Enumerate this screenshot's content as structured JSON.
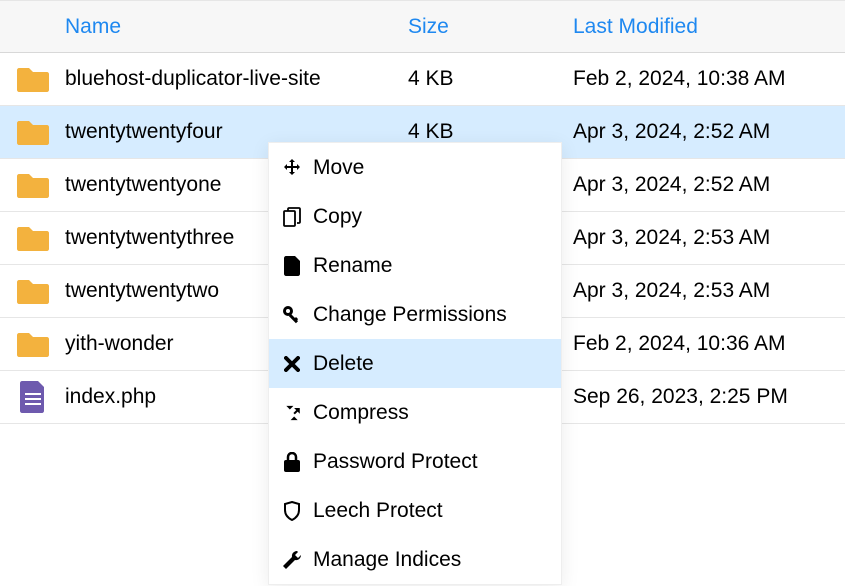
{
  "columns": {
    "name": "Name",
    "size": "Size",
    "modified": "Last Modified"
  },
  "rows": [
    {
      "name": "bluehost-duplicator-live-site",
      "size": "4 KB",
      "modified": "Feb 2, 2024, 10:38 AM",
      "type": "folder"
    },
    {
      "name": "twentytwentyfour",
      "size": "4 KB",
      "modified": "Apr 3, 2024, 2:52 AM",
      "type": "folder"
    },
    {
      "name": "twentytwentyone",
      "size": "",
      "modified": "Apr 3, 2024, 2:52 AM",
      "type": "folder"
    },
    {
      "name": "twentytwentythree",
      "size": "",
      "modified": "Apr 3, 2024, 2:53 AM",
      "type": "folder"
    },
    {
      "name": "twentytwentytwo",
      "size": "",
      "modified": "Apr 3, 2024, 2:53 AM",
      "type": "folder"
    },
    {
      "name": "yith-wonder",
      "size": "",
      "modified": "Feb 2, 2024, 10:36 AM",
      "type": "folder"
    },
    {
      "name": "index.php",
      "size": "",
      "modified": "Sep 26, 2023, 2:25 PM",
      "type": "file"
    }
  ],
  "context_menu": {
    "move": "Move",
    "copy": "Copy",
    "rename": "Rename",
    "change_permissions": "Change Permissions",
    "delete": "Delete",
    "compress": "Compress",
    "password_protect": "Password Protect",
    "leech_protect": "Leech Protect",
    "manage_indices": "Manage Indices"
  }
}
